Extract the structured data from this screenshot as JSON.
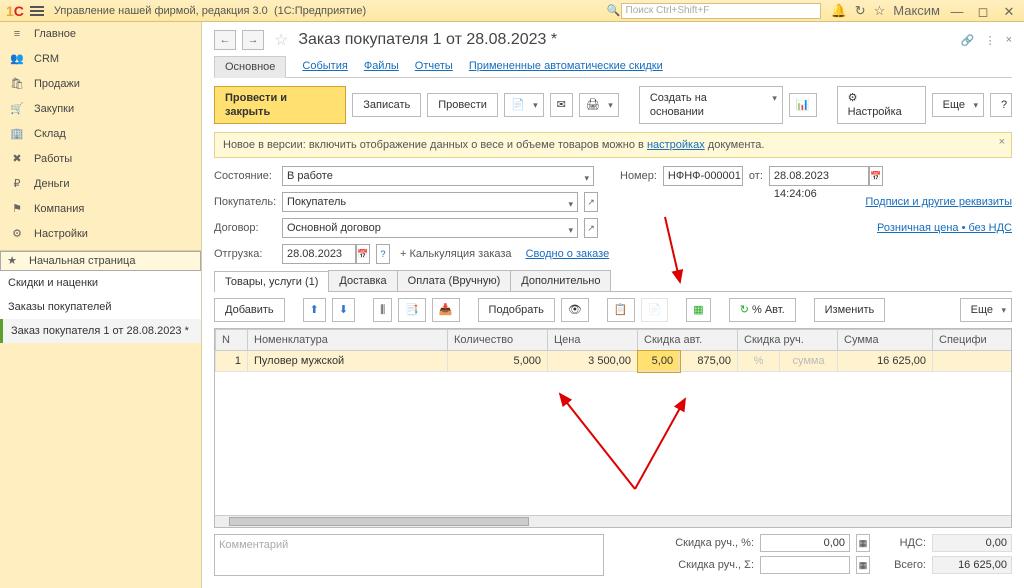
{
  "titlebar": {
    "app": "Управление нашей фирмой, редакция 3.0",
    "suffix": "(1С:Предприятие)",
    "search_ph": "Поиск Ctrl+Shift+F",
    "user": "Максим"
  },
  "sidebar": {
    "items": [
      {
        "icon": "≡",
        "label": "Главное"
      },
      {
        "icon": "🗂",
        "label": "CRM"
      },
      {
        "icon": "🛍",
        "label": "Продажи"
      },
      {
        "icon": "🛒",
        "label": "Закупки"
      },
      {
        "icon": "🏢",
        "label": "Склад"
      },
      {
        "icon": "🛠",
        "label": "Работы"
      },
      {
        "icon": "₽",
        "label": "Деньги"
      },
      {
        "icon": "🏁",
        "label": "Компания"
      },
      {
        "icon": "⚙",
        "label": "Настройки"
      }
    ],
    "sub": [
      {
        "icon": "★",
        "label": "Начальная страница"
      },
      {
        "label": "Скидки и наценки"
      },
      {
        "label": "Заказы покупателей"
      },
      {
        "label": "Заказ покупателя 1 от 28.08.2023 *"
      }
    ]
  },
  "doc": {
    "title": "Заказ покупателя 1 от 28.08.2023 *"
  },
  "tabs1": {
    "t0": "Основное",
    "t1": "События",
    "t2": "Файлы",
    "t3": "Отчеты",
    "t4": "Примененные автоматические скидки"
  },
  "toolbar": {
    "post_close": "Провести и закрыть",
    "save": "Записать",
    "post": "Провести",
    "create": "Создать на основании",
    "settings": "Настройка",
    "more": "Еще"
  },
  "info": {
    "text_a": "Новое в версии: включить отображение данных о весе и объеме товаров можно в ",
    "text_link": "настройках",
    "text_b": " документа."
  },
  "form": {
    "state_lbl": "Состояние:",
    "state": "В работе",
    "buyer_lbl": "Покупатель:",
    "buyer": "Покупатель",
    "contract_lbl": "Договор:",
    "contract": "Основной договор",
    "ship_lbl": "Отгрузка:",
    "ship": "28.08.2023",
    "calc": "+ Калькуляция заказа",
    "brief": "Сводно о заказе",
    "num_lbl": "Номер:",
    "num": "НФНФ-000001",
    "from_lbl": "от:",
    "from": "28.08.2023 14:24:06",
    "link_sign": "Подписи и другие реквизиты",
    "link_price": "Розничная цена • без НДС"
  },
  "tabs2": {
    "t0": "Товары, услуги (1)",
    "t1": "Доставка",
    "t2": "Оплата (Вручную)",
    "t3": "Дополнительно"
  },
  "tbl_toolbar": {
    "add": "Добавить",
    "pick": "Подобрать",
    "auto": "% Авт.",
    "change": "Изменить",
    "more": "Еще"
  },
  "cols": {
    "n": "N",
    "nom": "Номенклатура",
    "qty": "Количество",
    "price": "Цена",
    "da": "Скидка авт.",
    "dm": "Скидка руч.",
    "sum": "Сумма",
    "spec": "Специфи"
  },
  "row": {
    "n": "1",
    "nom": "Пуловер мужской",
    "qty": "5,000",
    "price": "3 500,00",
    "da": "5,00",
    "da_amt": "875,00",
    "dm_pc": "%",
    "dm_sum": "сумма",
    "sum": "16 625,00"
  },
  "footer": {
    "comment_ph": "Комментарий",
    "d_pc_lbl": "Скидка руч., %:",
    "d_pc": "0,00",
    "d_sum_lbl": "Скидка руч., Σ:",
    "nds_lbl": "НДС:",
    "nds": "0,00",
    "total_lbl": "Всего:",
    "total": "16 625,00"
  }
}
